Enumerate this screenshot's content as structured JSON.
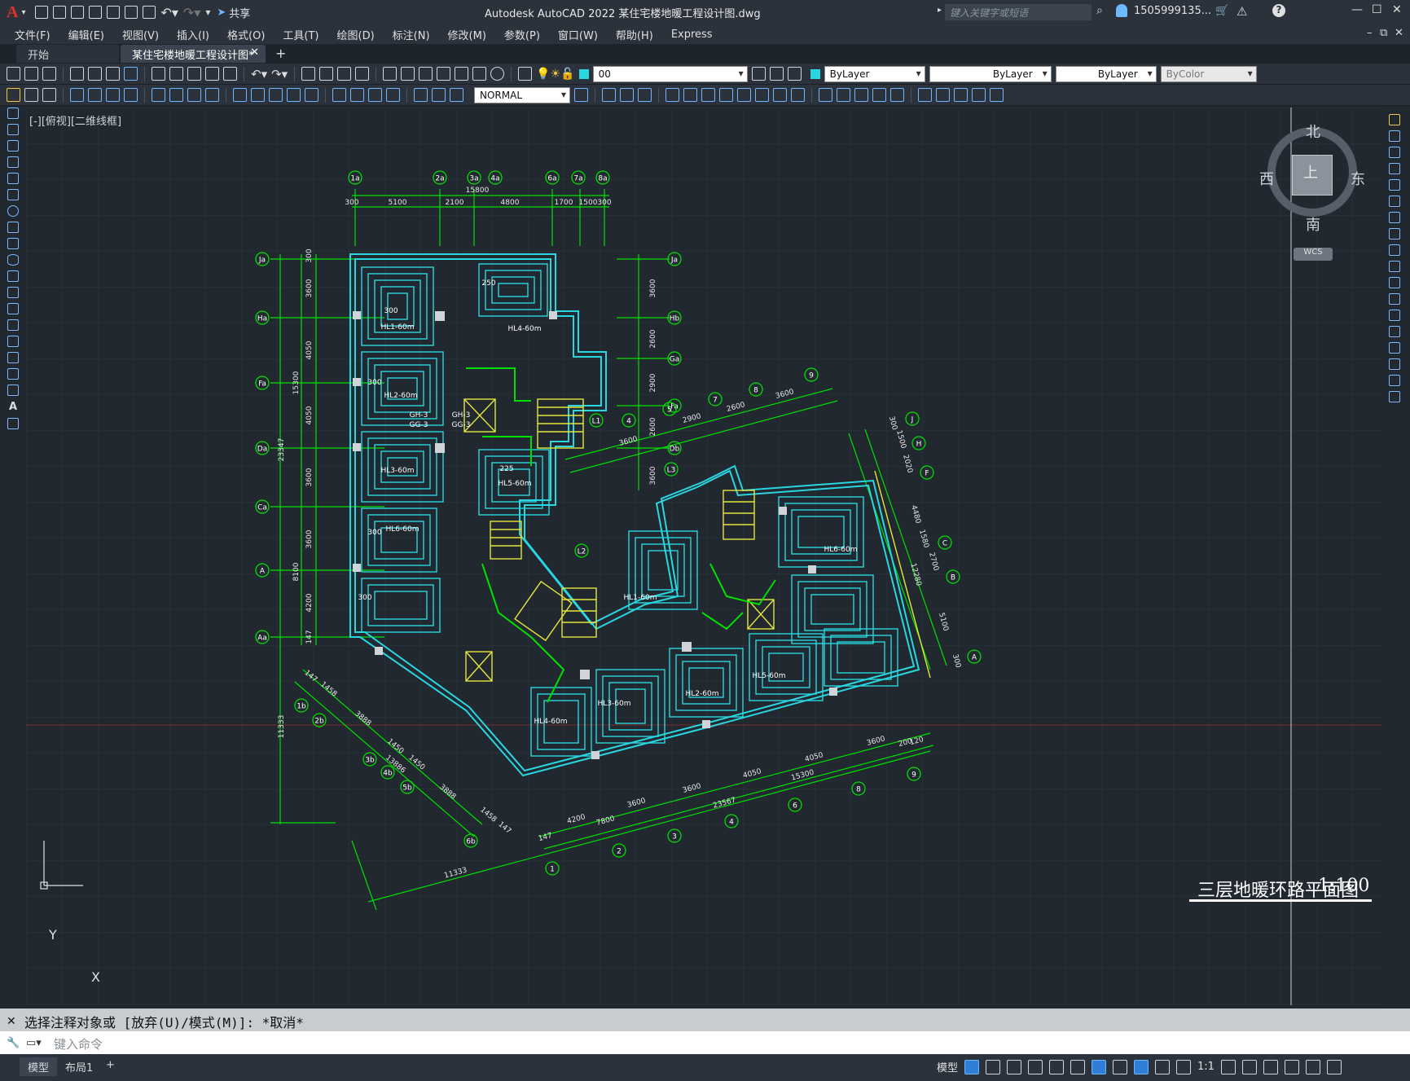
{
  "app": {
    "logo": "A",
    "share": "共享",
    "title": "Autodesk AutoCAD 2022    某住宅楼地暖工程设计图.dwg",
    "search_placeholder": "键入关键字或短语",
    "user": "1505999135...",
    "accent": "#2f7fd6"
  },
  "menu": [
    "文件(F)",
    "编辑(E)",
    "视图(V)",
    "插入(I)",
    "格式(O)",
    "工具(T)",
    "绘图(D)",
    "标注(N)",
    "修改(M)",
    "参数(P)",
    "窗口(W)",
    "帮助(H)",
    "Express"
  ],
  "tabs": {
    "start": "开始",
    "active": "某住宅楼地暖工程设计图*",
    "add": "+"
  },
  "toolbar": {
    "layer": "00",
    "color": "ByLayer",
    "linetype": "ByLayer",
    "lineweight": "ByLayer",
    "plotstyle": "ByColor",
    "dimstyle": "NORMAL"
  },
  "viewport": {
    "label": "[-][俯视][二维线框]"
  },
  "viewcube": {
    "north": "北",
    "south": "南",
    "east": "东",
    "west": "西",
    "top": "上",
    "wcs": "WCS"
  },
  "drawing": {
    "title": "三层地暖环路平面图",
    "scale": "1:100",
    "line_color": "#2ad6e0",
    "grid_color": "#00e000",
    "stair_color": "#e6e63a",
    "axes_top": [
      "1a",
      "2a",
      "3a",
      "4a",
      "6a",
      "7a",
      "8a"
    ],
    "dims_top": [
      "300",
      "5100",
      "2100",
      "4800",
      "1700",
      "1500",
      "300"
    ],
    "dims_top_total": "15800",
    "axes_left": [
      "Ja",
      "Ha",
      "Fa",
      "Da",
      "Ca",
      "A",
      "Aa"
    ],
    "dims_left": [
      "300",
      "3600",
      "4050",
      "4050",
      "3600",
      "3600",
      "4200",
      "147"
    ],
    "dims_left_total": [
      "15300",
      "23347",
      "8100",
      "11333"
    ],
    "axes_right": [
      "Ja",
      "Hb",
      "Ga",
      "Fa",
      "Db"
    ],
    "dims_right": [
      "3600",
      "2600",
      "2900",
      "2600",
      "3600"
    ],
    "axes_rot_top": [
      "4",
      "5",
      "7",
      "8",
      "9"
    ],
    "dims_rot_top": [
      "3600",
      "2900",
      "2600",
      "3600"
    ],
    "axes_rot_right": [
      "J",
      "H",
      "F",
      "C",
      "B",
      "A"
    ],
    "dims_rot_right": [
      "300",
      "1500",
      "2020",
      "4480",
      "1580",
      "2700",
      "12280",
      "5100",
      "300"
    ],
    "axes_bottom": [
      "1",
      "2",
      "3",
      "4",
      "6",
      "8",
      "9"
    ],
    "dims_bottom": [
      "4200",
      "3600",
      "3600",
      "4050",
      "4050",
      "3600",
      "200",
      "120"
    ],
    "dims_bottom_total": [
      "7800",
      "23567",
      "15300",
      "147",
      "11333"
    ],
    "axes_diag": [
      "1b",
      "2b",
      "3b",
      "4b",
      "5b",
      "6b"
    ],
    "dims_diag": [
      "147",
      "1458",
      "3888",
      "1450",
      "1450",
      "13886",
      "3888",
      "1458",
      "147"
    ],
    "loops": [
      "HL1-60m",
      "HL2-60m",
      "HL3-60m",
      "HL4-60m",
      "HL5-60m",
      "HL6-60m"
    ],
    "room_dims": [
      "300",
      "250",
      "225",
      "300",
      "300",
      "300"
    ],
    "risers": [
      "L1",
      "L2",
      "L3"
    ],
    "pipe_labels": [
      "GH-3",
      "GH-3",
      "GG-3",
      "GG-3"
    ]
  },
  "ucs": {
    "x": "X",
    "y": "Y"
  },
  "command": {
    "history": "选择注释对象或 [放弃(U)/模式(M)]: *取消*",
    "placeholder": "键入命令"
  },
  "status": {
    "model": "模型",
    "layout": "布局1",
    "add": "+",
    "mode": "模型",
    "scale": "1:1"
  }
}
